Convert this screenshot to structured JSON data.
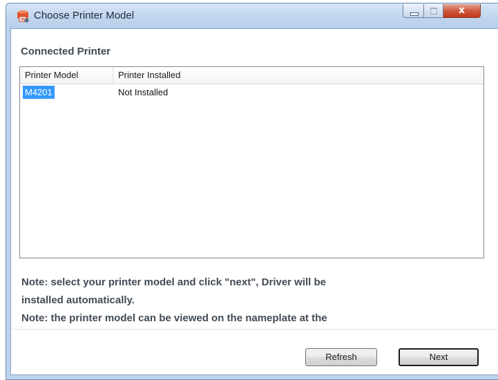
{
  "window": {
    "title": "Choose Printer Model",
    "controls": {
      "minimize_icon": "minimize-icon",
      "maximize_icon": "maximize-icon",
      "close_icon": "close-icon",
      "close_glyph": "x"
    }
  },
  "section": {
    "title": "Connected Printer"
  },
  "printer_list": {
    "columns": [
      "Printer Model",
      "Printer Installed"
    ],
    "rows": [
      {
        "model": "M4201",
        "installed": "Not Installed",
        "selected": true
      }
    ]
  },
  "notes": [
    "Note: select your printer model and click \"next\", Driver will be",
    "installed automatically.",
    "Note: the printer model can be viewed on the nameplate at the"
  ],
  "buttons": {
    "refresh_label": "Refresh",
    "next_label": "Next"
  },
  "colors": {
    "selection": "#3399ff",
    "title_bar": "#c3d7ee",
    "close_button": "#c2371a",
    "note_text": "#424b55"
  }
}
